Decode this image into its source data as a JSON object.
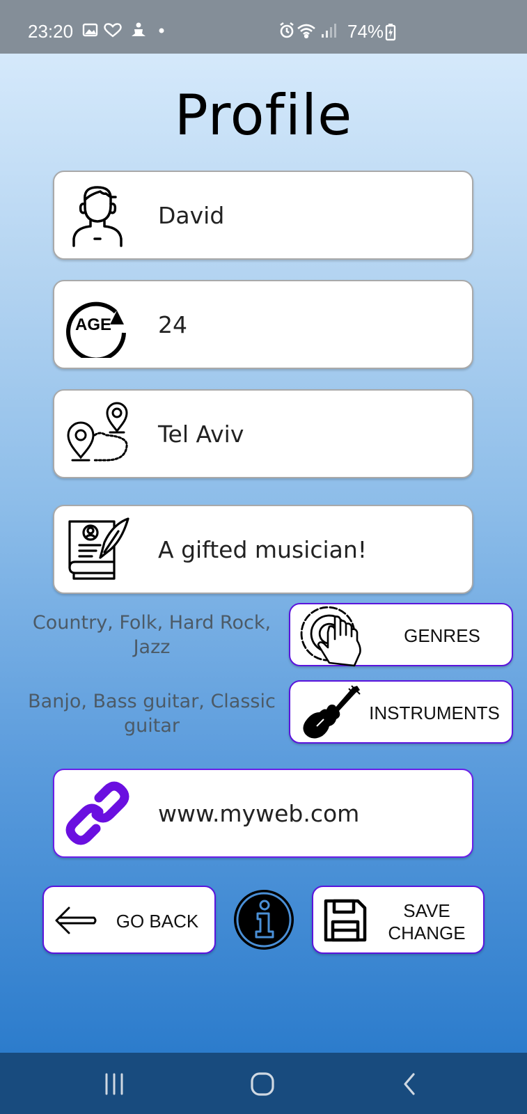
{
  "status_bar": {
    "time": "23:20",
    "battery": "74%"
  },
  "page": {
    "title": "Profile"
  },
  "profile": {
    "name": "David",
    "age": "24",
    "location": "Tel Aviv",
    "bio": "A gifted musician!",
    "website": "www.myweb.com",
    "age_icon_text": "AGE"
  },
  "genres": {
    "selected_text": "Country, Folk, Hard Rock, Jazz",
    "button_label": "GENRES"
  },
  "instruments": {
    "selected_text": "Banjo, Bass guitar, Classic guitar",
    "button_label": "INSTRUMENTS"
  },
  "actions": {
    "go_back_label": "GO BACK",
    "save_line1": "SAVE",
    "save_line2": "CHANGE"
  },
  "colors": {
    "accent_purple": "#6a1ee8",
    "link_icon": "#6a0fe0",
    "nav_bar": "#184b7e",
    "status_bar": "#848e98",
    "info_icon_stroke": "#4a8fd6"
  }
}
